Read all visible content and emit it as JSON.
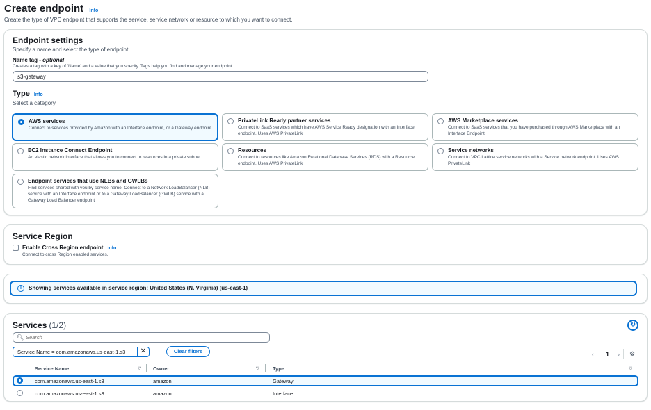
{
  "page": {
    "title": "Create endpoint",
    "info": "Info",
    "description": "Create the type of VPC endpoint that supports the service, service network or resource to which you want to connect."
  },
  "settings": {
    "title": "Endpoint settings",
    "subtitle": "Specify a name and select the type of endpoint.",
    "name_label": "Name tag",
    "name_optional": "optional",
    "name_desc": "Creates a tag with a key of 'Name' and a value that you specify. Tags help you find and manage your endpoint.",
    "name_value": "s3-gateway",
    "type_title": "Type",
    "type_info": "Info",
    "type_subtitle": "Select a category",
    "types": [
      {
        "title": "AWS services",
        "desc": "Connect to services provided by Amazon with an Interface endpoint, or a Gateway endpoint",
        "selected": true
      },
      {
        "title": "PrivateLink Ready partner services",
        "desc": "Connect to SaaS services which have AWS Service Ready designation with an Interface endpoint. Uses AWS PrivateLink",
        "selected": false
      },
      {
        "title": "AWS Marketplace services",
        "desc": "Connect to SaaS services that you have purchased through AWS Marketplace with an Interface Endpoint",
        "selected": false
      },
      {
        "title": "EC2 Instance Connect Endpoint",
        "desc": "An elastic network interface that allows you to connect to resources in a private subnet",
        "selected": false
      },
      {
        "title": "Resources",
        "desc": "Connect to resources like Amazon Relational Database Services (RDS) with a Resource endpoint. Uses AWS PrivateLink",
        "selected": false
      },
      {
        "title": "Service networks",
        "desc": "Connect to VPC Lattice service networks with a Service network endpoint. Uses AWS PrivateLink",
        "selected": false
      },
      {
        "title": "Endpoint services that use NLBs and GWLBs",
        "desc": "Find services shared with you by service name. Connect to a Network LoadBalancer (NLB) service with an Interface endpoint or to a Gateway LoadBalancer (GWLB) service with a Gateway Load Balancer endpoint",
        "selected": false
      }
    ]
  },
  "region": {
    "title": "Service Region",
    "checkbox_label": "Enable Cross Region endpoint",
    "info": "Info",
    "checkbox_desc": "Connect to cross Region enabled services.",
    "checked": false
  },
  "alert": {
    "icon": "i",
    "text": "Showing services available in service region: United States (N. Virginia) (us-east-1)"
  },
  "services": {
    "title": "Services",
    "count": "(1/2)",
    "search_placeholder": "Search",
    "filter_token": "Service Name = com.amazonaws.us-east-1.s3",
    "clear_filters": "Clear filters",
    "page": "1",
    "columns": [
      "Service Name",
      "Owner",
      "Type"
    ],
    "rows": [
      {
        "name": "com.amazonaws.us-east-1.s3",
        "owner": "amazon",
        "type": "Gateway",
        "selected": true
      },
      {
        "name": "com.amazonaws.us-east-1.s3",
        "owner": "amazon",
        "type": "Interface",
        "selected": false
      }
    ]
  },
  "icons": {
    "refresh": "refresh-icon",
    "search": "search-icon",
    "close": "close-icon",
    "prev": "chevron-left-icon",
    "next": "chevron-right-icon",
    "settings": "gear-icon",
    "sort": "caret-down-icon",
    "info": "info-circle-icon"
  },
  "colors": {
    "accent": "#0972d3",
    "selected_bg": "#f1faff",
    "border": "#d5dbdb",
    "text": "#16191f"
  }
}
